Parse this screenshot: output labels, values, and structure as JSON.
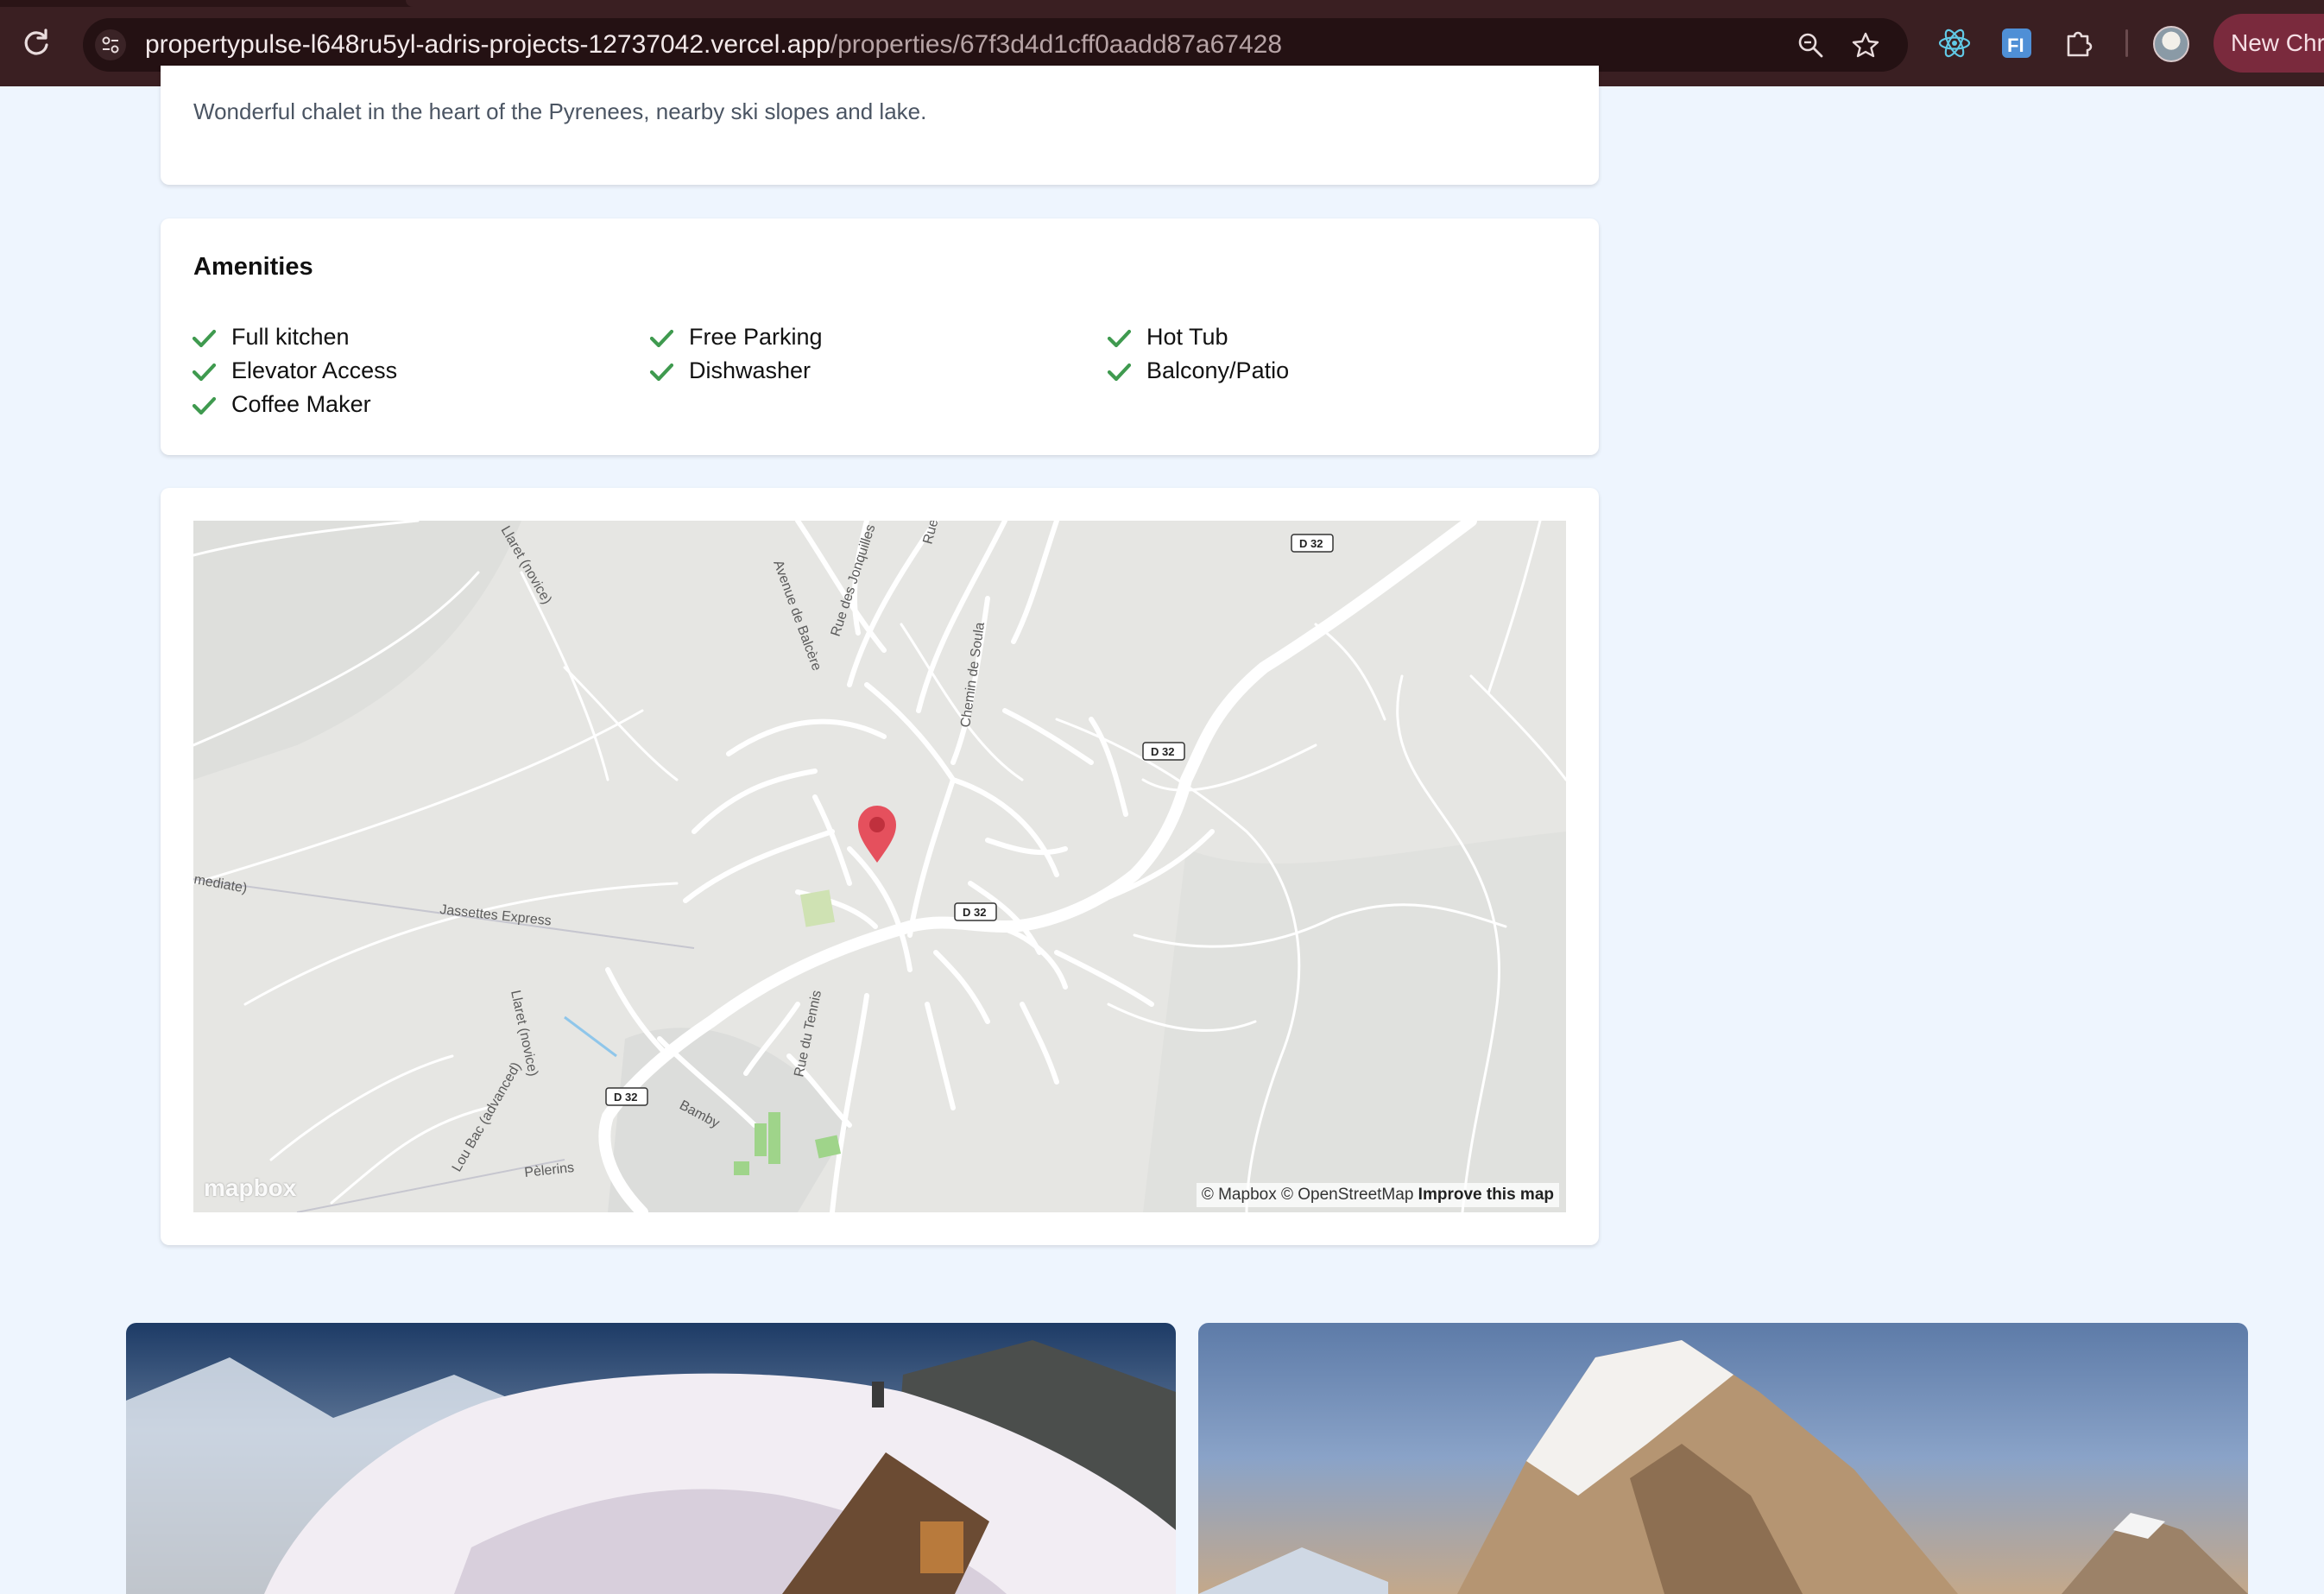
{
  "browser": {
    "url_host": "propertypulse-l648ru5yl-adris-projects-12737042.vercel.app",
    "url_path": "/properties/67f3d4d1cff0aadd87a67428",
    "new_chrome_label": "New Chrome"
  },
  "property": {
    "description": "Wonderful chalet in the heart of the Pyrenees, nearby ski slopes and lake."
  },
  "amenities": {
    "title": "Amenities",
    "items": [
      "Full kitchen",
      "Free Parking",
      "Hot Tub",
      "Elevator Access",
      "Dishwasher",
      "Balcony/Patio",
      "Coffee Maker"
    ]
  },
  "map": {
    "labels": {
      "road_d32": "D 32",
      "llaret_novice": "Llaret (novice)",
      "avenue_balcere": "Avenue de Balcère",
      "rue_jonquilles": "Rue des Jonquilles",
      "rue": "Rue",
      "chemin_soula": "Chemin de Soula",
      "intermediate": "mediate)",
      "jassettes": "Jassettes Express",
      "llaret_novice_2": "Llaret (novice)",
      "rue_tennis": "Rue du Tennis",
      "lou_bac": "Lou Bac (advanced)",
      "bamby": "Bamby",
      "pelerins": "Pèlerins"
    },
    "attribution": "© Mapbox © OpenStreetMap",
    "improve": "Improve this map",
    "logo": "mapbox"
  },
  "colors": {
    "page_bg": "#eef5fe",
    "check_green": "#3f9a4f",
    "marker_red": "#e5505d"
  }
}
